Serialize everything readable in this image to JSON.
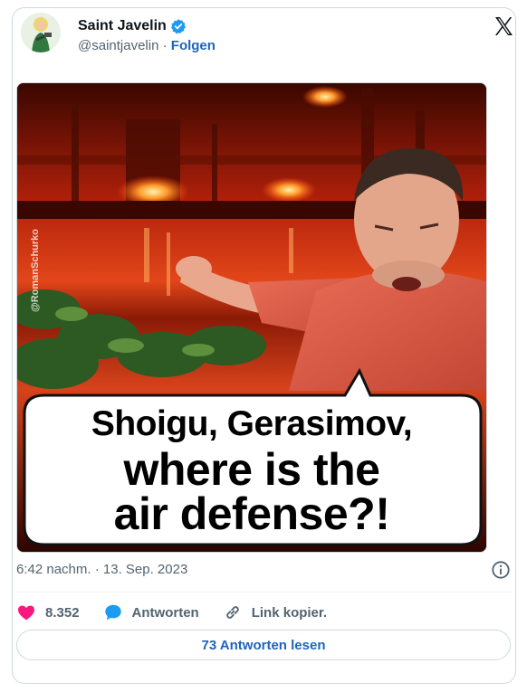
{
  "author": {
    "name": "Saint Javelin",
    "handle": "@saintjavelin",
    "separator": " · ",
    "follow_label": "Folgen"
  },
  "media": {
    "watermark": "@RomanSchurko",
    "speech_lines": [
      "Shoigu, Gerasimov,",
      "where is the",
      "air defense?!"
    ]
  },
  "timestamp": "6:42 nachm. · 13. Sep. 2023",
  "actions": {
    "likes": "8.352",
    "reply_label": "Antworten",
    "copy_link_label": "Link kopier."
  },
  "read_replies_label": "73 Antworten lesen",
  "colors": {
    "link_blue": "#1d64bd",
    "verified_blue": "#1d9bf0",
    "like_red": "#f91880",
    "reply_blue": "#1d9bf0"
  },
  "icons": [
    "verified-badge-icon",
    "x-logo-icon",
    "info-icon",
    "heart-icon",
    "reply-bubble-icon",
    "link-icon"
  ]
}
